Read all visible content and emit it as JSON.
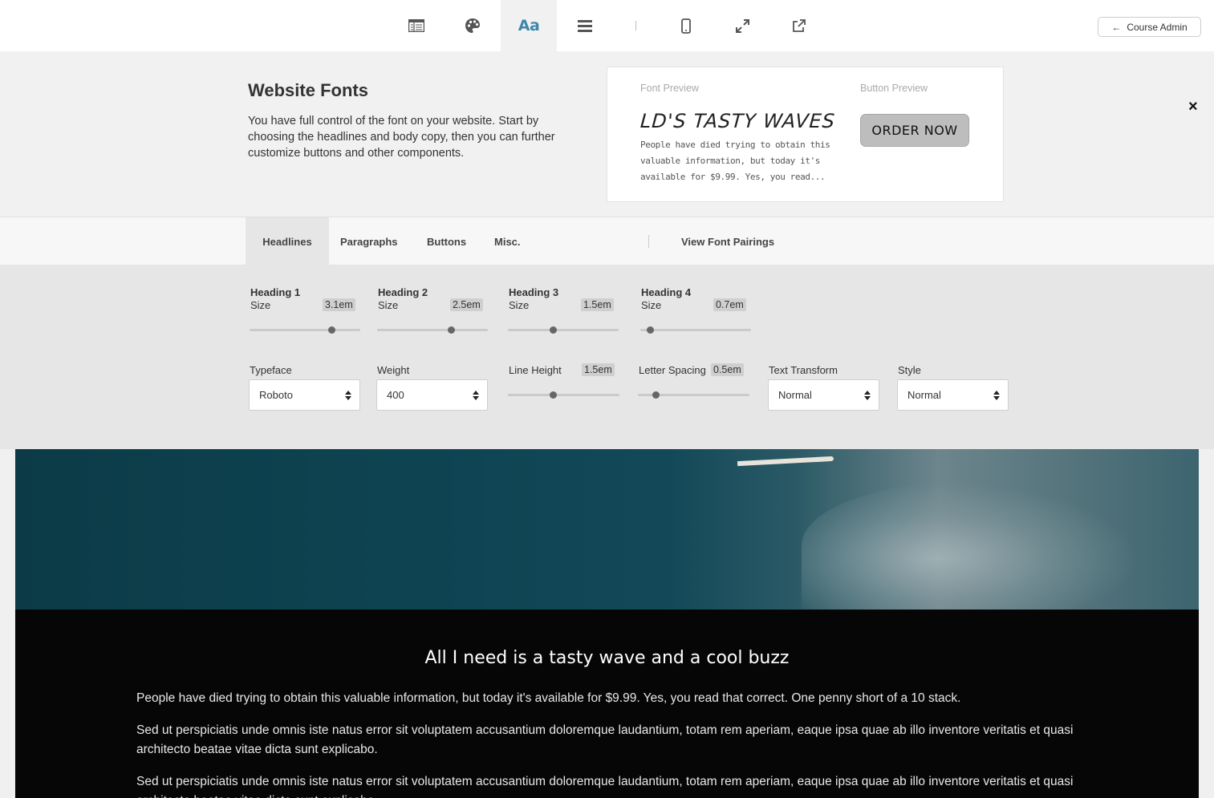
{
  "toolbar": {
    "items": [
      {
        "name": "layout",
        "icon": "layout-grid-icon"
      },
      {
        "name": "colors",
        "icon": "palette-icon"
      },
      {
        "name": "fonts",
        "icon": "font-aa-icon",
        "label": "Aa",
        "active": true
      },
      {
        "name": "navigation",
        "icon": "menu-bars-icon"
      },
      {
        "name": "mobile",
        "icon": "mobile-phone-icon"
      },
      {
        "name": "fullscreen",
        "icon": "expand-icon"
      },
      {
        "name": "open-external",
        "icon": "external-link-icon"
      }
    ],
    "accent_color": "#3d87ad",
    "course_admin_label": "Course Admin"
  },
  "panel": {
    "title": "Website Fonts",
    "description": "You have full control of the font on your website. Start by choosing the headlines and body copy, then you can further customize buttons and other components.",
    "preview": {
      "font_preview_label": "Font Preview",
      "button_preview_label": "Button Preview",
      "heading": "LD'S TASTY WAVES",
      "body": "People have died trying to obtain this valuable information, but today it's available for $9.99. Yes, you read...",
      "button_label": "ORDER NOW"
    },
    "close_label": "×"
  },
  "tabs": [
    {
      "label": "Headlines",
      "active": true
    },
    {
      "label": "Paragraphs"
    },
    {
      "label": "Buttons"
    },
    {
      "label": "Misc."
    },
    {
      "label": "View Font Pairings"
    }
  ],
  "controls": {
    "headings": [
      {
        "title": "Heading 1",
        "size_label": "Size",
        "value": "3.1em",
        "level": 0.76
      },
      {
        "title": "Heading 2",
        "size_label": "Size",
        "value": "2.5em",
        "level": 0.68
      },
      {
        "title": "Heading 3",
        "size_label": "Size",
        "value": "1.5em",
        "level": 0.4
      },
      {
        "title": "Heading 4",
        "size_label": "Size",
        "value": "0.7em",
        "level": 0.06
      }
    ],
    "typeface": {
      "label": "Typeface",
      "value": "Roboto"
    },
    "weight": {
      "label": "Weight",
      "value": "400"
    },
    "line_height": {
      "label": "Line Height",
      "value": "1.5em",
      "level": 0.4
    },
    "letter_spacing": {
      "label": "Letter Spacing",
      "value": "0.5em",
      "level": 0.14
    },
    "text_transform": {
      "label": "Text Transform",
      "value": "Normal"
    },
    "style": {
      "label": "Style",
      "value": "Normal"
    }
  },
  "site": {
    "heading": "All I need is a tasty wave and a cool buzz",
    "paragraphs": [
      "People have died trying to obtain this valuable information, but today it's available for $9.99. Yes, you read that correct. One penny short of a 10 stack.",
      "Sed ut perspiciatis unde omnis iste natus error sit voluptatem accusantium doloremque laudantium, totam rem aperiam, eaque ipsa quae ab illo inventore veritatis et quasi architecto beatae vitae dicta sunt explicabo.",
      "Sed ut perspiciatis unde omnis iste natus error sit voluptatem accusantium doloremque laudantium, totam rem aperiam, eaque ipsa quae ab illo inventore veritatis et quasi architecto beatae vitae dicta sunt explicabo."
    ]
  }
}
